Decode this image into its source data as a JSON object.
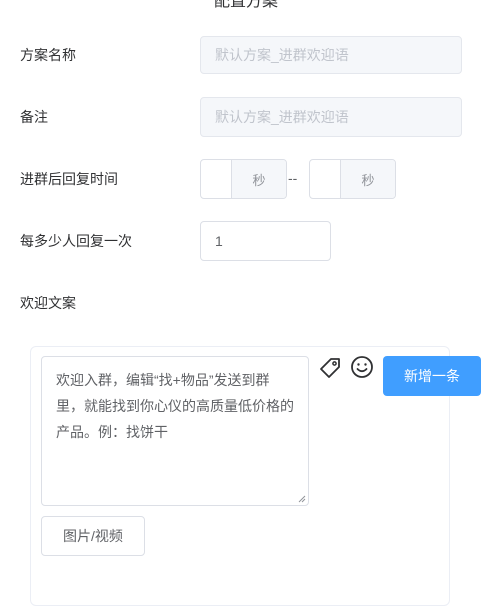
{
  "page": {
    "title": "配置方案"
  },
  "form": {
    "scheme_name": {
      "label": "方案名称",
      "placeholder": "默认方案_进群欢迎语"
    },
    "remark": {
      "label": "备注",
      "placeholder": "默认方案_进群欢迎语"
    },
    "reply_time": {
      "label": "进群后回复时间",
      "unit1": "秒",
      "separator": "--",
      "unit2": "秒"
    },
    "reply_every": {
      "label": "每多少人回复一次",
      "value": "1"
    },
    "welcome": {
      "label": "欢迎文案",
      "text": "欢迎入群，编辑“找+物品”发送到群里，就能找到你心仪的高质量低价格的产品。例：找饼干",
      "media_button": "图片/视频",
      "add_button": "新增一条",
      "icons": [
        "tag-icon",
        "smiley-icon"
      ]
    }
  }
}
